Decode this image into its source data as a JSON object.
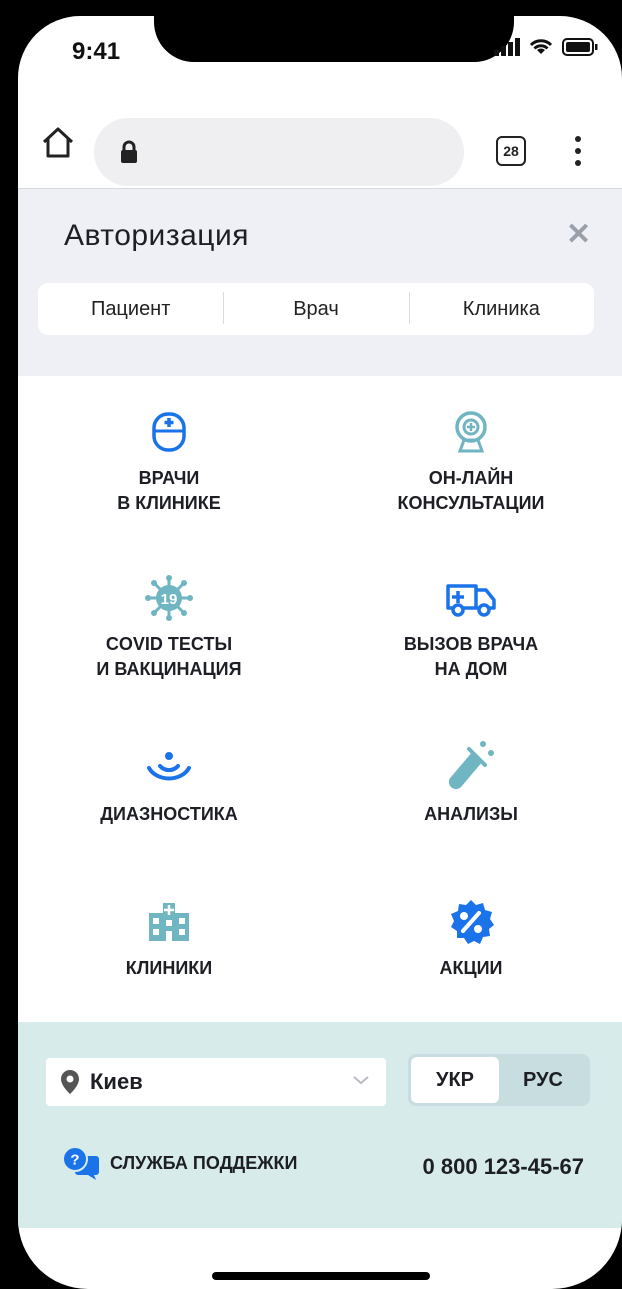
{
  "status": {
    "time": "9:41"
  },
  "browser": {
    "tabs_count": "28"
  },
  "auth": {
    "title": "Авторизация",
    "tabs": [
      {
        "label": "Пациент"
      },
      {
        "label": "Врач"
      },
      {
        "label": "Клиника"
      }
    ]
  },
  "services": [
    {
      "label": "ВРАЧИ\nВ КЛИНИКЕ",
      "icon": "mouse-cross-icon"
    },
    {
      "label": "ОН-ЛАЙН\nКОНСУЛЬТАЦИИ",
      "icon": "webcam-icon"
    },
    {
      "label": "COVID ТЕСТЫ\nИ ВАКЦИНАЦИЯ",
      "icon": "virus-icon",
      "badge": "19"
    },
    {
      "label": "ВЫЗОВ ВРАЧА\nНА ДОМ",
      "icon": "ambulance-icon"
    },
    {
      "label": "ДИАЗНОСТИКА",
      "icon": "signal-icon"
    },
    {
      "label": "АНАЛИЗЫ",
      "icon": "test-tube-icon"
    },
    {
      "label": "КЛИНИКИ",
      "icon": "hospital-icon"
    },
    {
      "label": "АКЦИИ",
      "icon": "discount-badge-icon"
    }
  ],
  "footer": {
    "city": "Киев",
    "languages": [
      {
        "label": "УКР",
        "active": true
      },
      {
        "label": "РУС",
        "active": false
      }
    ],
    "support_label": "СЛУЖБА ПОДДЕЖКИ",
    "support_badge": "?",
    "phone": "0 800 123-45-67"
  },
  "colors": {
    "accent_blue": "#1a73e8",
    "accent_teal": "#6fb5c2",
    "footer_bg": "#d8ebeb",
    "auth_bg": "#eef0f5"
  }
}
